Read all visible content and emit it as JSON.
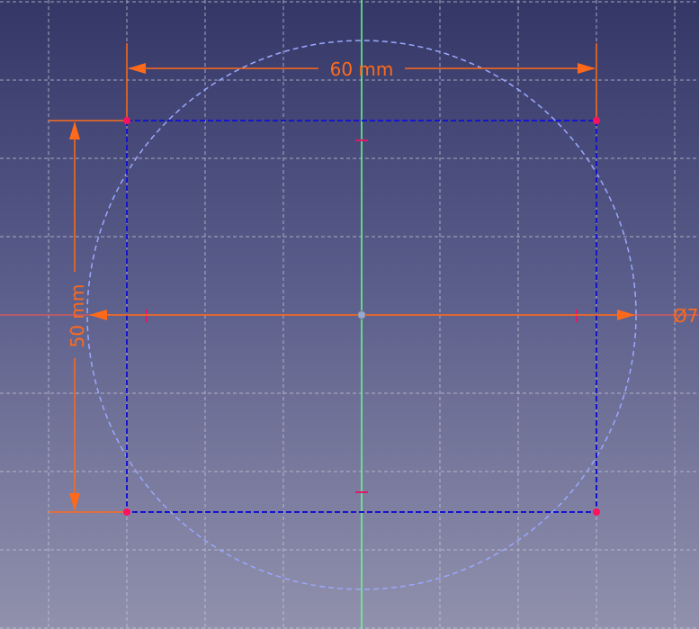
{
  "sketch": {
    "width_dimension": "60 mm",
    "height_dimension": "50 mm",
    "diameter_dimension": "Ø7"
  },
  "colors": {
    "background_top": "#343766",
    "background_bottom": "#9191ad",
    "grid": "#c8c8d8",
    "construction_geometry": "#1515cc",
    "circle": "#9aa8ff",
    "dimension": "#ff6a1a",
    "vertical_axis": "#66ff88",
    "horizontal_axis": "#e05a5a",
    "constraint_marks": "#e0186a"
  }
}
